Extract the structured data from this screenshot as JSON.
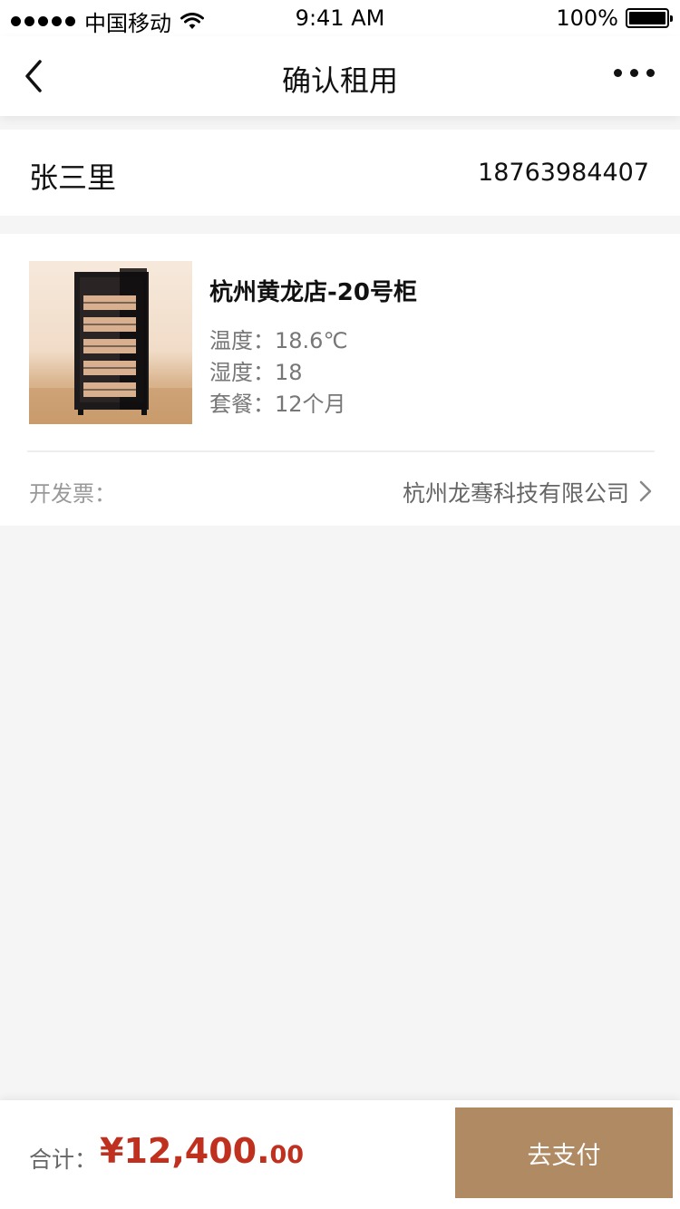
{
  "status_bar": {
    "carrier": "中国移动",
    "time": "9:41 AM",
    "battery": "100%",
    "battery_level": 1.0
  },
  "nav": {
    "title": "确认租用",
    "back_icon": "chevron-left-icon",
    "more_icon": "more-dots-icon"
  },
  "contact": {
    "name": "张三里",
    "phone": "18763984407"
  },
  "product": {
    "title": "杭州黄龙店-20号柜",
    "temperature_label": "温度：",
    "temperature_value": "18.6℃",
    "humidity_label": "湿度：",
    "humidity_value": "18",
    "package_label": "套餐：",
    "package_value": "12个月",
    "image_icon": "cabinet-image"
  },
  "invoice": {
    "label": "开发票：",
    "value": "杭州龙骞科技有限公司",
    "chevron_icon": "chevron-right-icon"
  },
  "footer": {
    "total_label": "合计：",
    "total_main": "¥12,400.",
    "total_cents": "00",
    "pay_button": "去支付"
  },
  "colors": {
    "accent_button": "#b08a63",
    "price_red": "#c0301f",
    "page_bg": "#f5f5f5"
  }
}
